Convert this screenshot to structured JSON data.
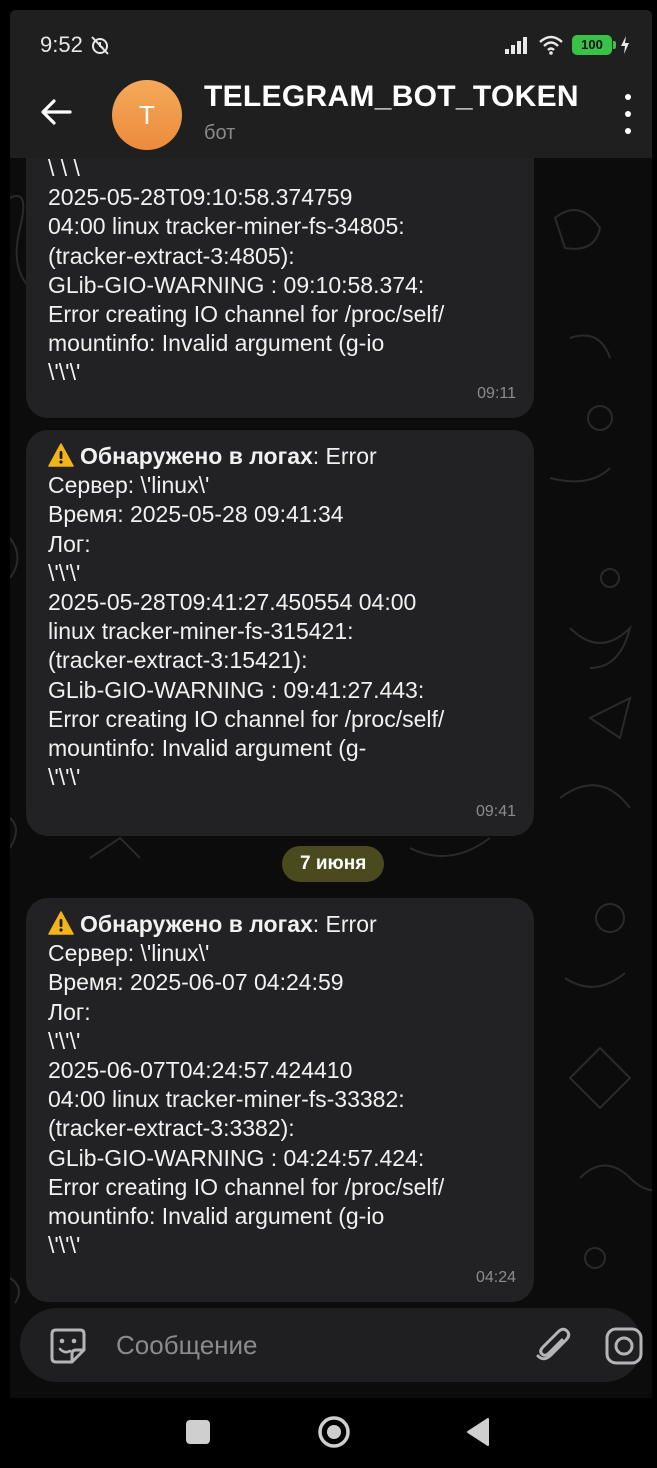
{
  "status_bar": {
    "time": "9:52",
    "battery": "100"
  },
  "header": {
    "avatar_letter": "T",
    "title": "TELEGRAM_BOT_TOKEN",
    "subtitle": "бот"
  },
  "messages": [
    {
      "lines": [
        "\\ \\ \\",
        "2025-05-28T09:10:58.374759",
        "04:00 linux tracker-miner-fs-34805:",
        "(tracker-extract-3:4805):",
        "GLib-GIO-WARNING : 09:10:58.374:",
        "Error creating IO channel for /proc/self/",
        "mountinfo: Invalid argument (g-io",
        "\\'\\'\\'"
      ],
      "time": "09:11"
    },
    {
      "alert_bold": "Обнаружено в логах",
      "alert_rest": ": Error",
      "lines": [
        "Сервер: \\'linux\\'",
        "Время: 2025-05-28 09:41:34",
        "Лог:",
        "\\'\\'\\'",
        "2025-05-28T09:41:27.450554 04:00",
        "linux tracker-miner-fs-315421:",
        "(tracker-extract-3:15421):",
        "GLib-GIO-WARNING : 09:41:27.443:",
        "Error creating IO channel for /proc/self/",
        "mountinfo: Invalid argument (g-",
        "\\'\\'\\'"
      ],
      "time": "09:41"
    },
    {
      "alert_bold": "Обнаружено в логах",
      "alert_rest": ": Error",
      "lines": [
        "Сервер: \\'linux\\'",
        "Время: 2025-06-07 04:24:59",
        "Лог:",
        "\\'\\'\\'",
        "2025-06-07T04:24:57.424410",
        "04:00 linux tracker-miner-fs-33382:",
        "(tracker-extract-3:3382):",
        "GLib-GIO-WARNING : 04:24:57.424:",
        "Error creating IO channel for /proc/self/",
        "mountinfo: Invalid argument (g-io",
        "\\'\\'\\'"
      ],
      "time": "04:24"
    }
  ],
  "date_separator": "7 июня",
  "composer": {
    "placeholder": "Сообщение"
  },
  "colors": {
    "accent_avatar": "#ec8b3c",
    "bubble": "#222224",
    "date_chip": "#4b4a1e",
    "battery": "#39c24a"
  }
}
